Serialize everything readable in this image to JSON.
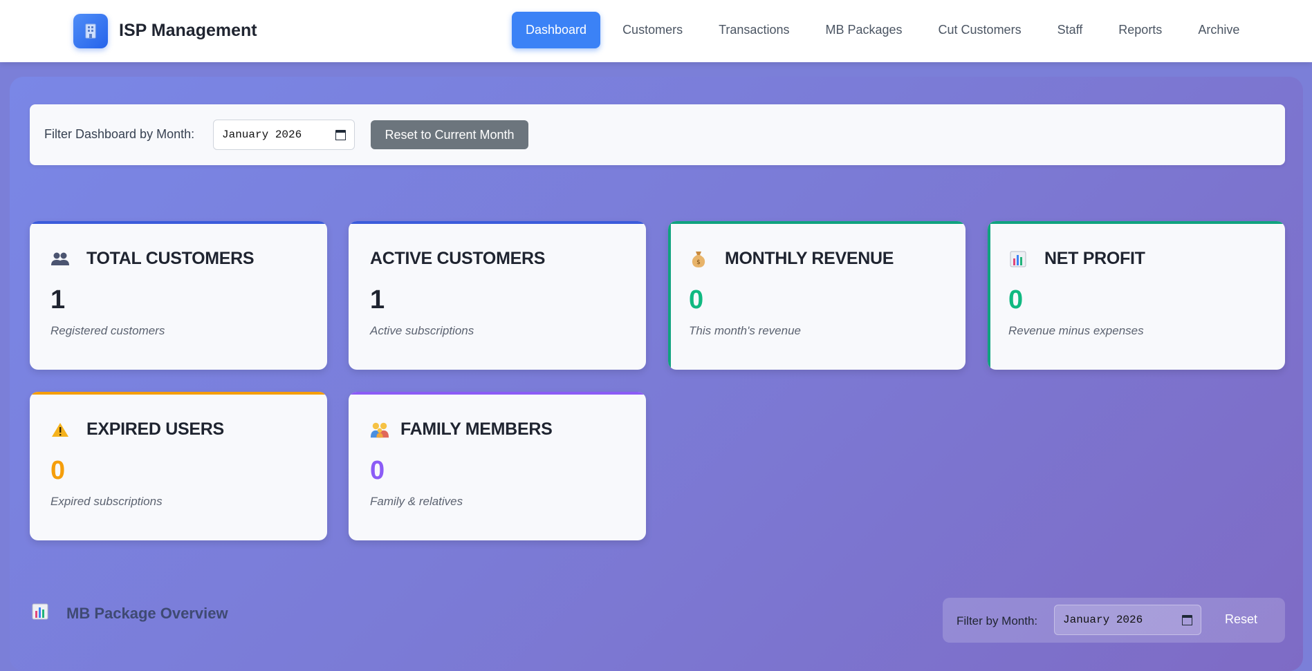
{
  "app": {
    "title": "ISP Management",
    "logo_icon": "building-icon"
  },
  "nav": {
    "items": [
      {
        "label": "Dashboard",
        "active": true
      },
      {
        "label": "Customers",
        "active": false
      },
      {
        "label": "Transactions",
        "active": false
      },
      {
        "label": "MB Packages",
        "active": false
      },
      {
        "label": "Cut Customers",
        "active": false
      },
      {
        "label": "Staff",
        "active": false
      },
      {
        "label": "Reports",
        "active": false
      },
      {
        "label": "Archive",
        "active": false
      }
    ]
  },
  "filter": {
    "label": "Filter Dashboard by Month:",
    "value": "January 2026",
    "reset_label": "Reset to Current Month"
  },
  "cards": [
    {
      "title": "TOTAL CUSTOMERS",
      "value": "1",
      "sub": "Registered customers",
      "icon": "people-icon",
      "accent": "#3b5bdb",
      "value_color": "#1f2430"
    },
    {
      "title": "ACTIVE CUSTOMERS",
      "value": "1",
      "sub": "Active subscriptions",
      "icon": "",
      "accent": "#3b5bdb",
      "value_color": "#1f2430"
    },
    {
      "title": "MONTHLY REVENUE",
      "value": "0",
      "sub": "This month's revenue",
      "icon": "money-bag-icon",
      "accent": "#10a37f",
      "value_color": "#10b981"
    },
    {
      "title": "NET PROFIT",
      "value": "0",
      "sub": "Revenue minus expenses",
      "icon": "bar-chart-icon",
      "accent": "#10a37f",
      "value_color": "#10b981"
    },
    {
      "title": "EXPIRED USERS",
      "value": "0",
      "sub": "Expired subscriptions",
      "icon": "warning-icon",
      "accent": "#f59e0b",
      "value_color": "#f59e0b"
    },
    {
      "title": "FAMILY MEMBERS",
      "value": "0",
      "sub": "Family & relatives",
      "icon": "family-icon",
      "accent": "#8b5cf6",
      "value_color": "#8b5cf6"
    }
  ],
  "packages": {
    "title": "MB Package Overview",
    "icon": "bar-chart-icon",
    "filter_label": "Filter by Month:",
    "filter_value": "January 2026",
    "reset_label": "Reset"
  }
}
